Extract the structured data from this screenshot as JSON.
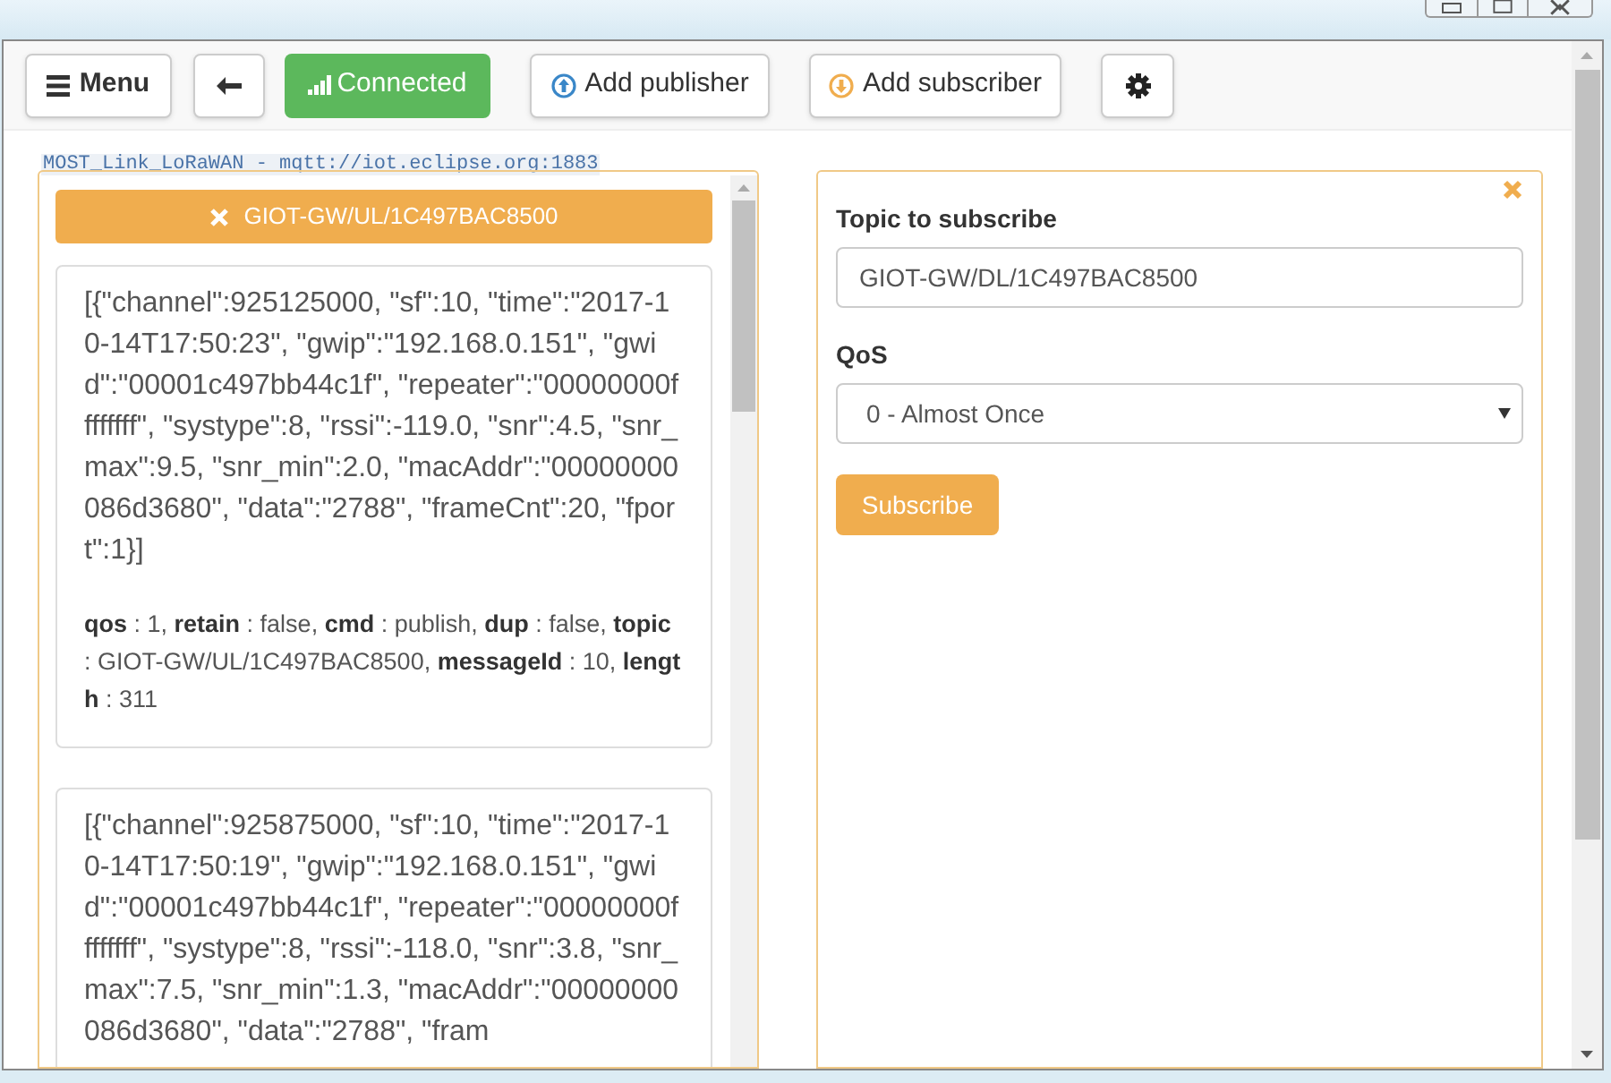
{
  "toolbar": {
    "menu": "Menu",
    "status": {
      "label": "Connected",
      "connected": true
    },
    "add_publisher": "Add publisher",
    "add_subscriber": "Add subscriber"
  },
  "connection": "MOST_Link_LoRaWAN - mqtt://iot.eclipse.org:1883",
  "subscription": {
    "topic": "GIOT-GW/UL/1C497BAC8500",
    "messages": [
      {
        "payload": "[{\"channel\":925125000, \"sf\":10, \"time\":\"2017-10-14T17:50:23\", \"gwip\":\"192.168.0.151\", \"gwid\":\"00001c497bb44c1f\", \"repeater\":\"00000000ffffffff\", \"systype\":8, \"rssi\":-119.0, \"snr\":4.5, \"snr_max\":9.5, \"snr_min\":2.0, \"macAddr\":\"00000000086d3680\", \"data\":\"2788\", \"frameCnt\":20, \"fport\":1}]",
        "meta": "**qos** : 1, **retain** : false, **cmd** : publish, **dup** : false, **topic** : GIOT-GW/UL/1C497BAC8500, **messageId** : 10, **length** : 311"
      },
      {
        "payload": "[{\"channel\":925875000, \"sf\":10, \"time\":\"2017-10-14T17:50:19\", \"gwip\":\"192.168.0.151\", \"gwid\":\"00001c497bb44c1f\", \"repeater\":\"00000000ffffffff\", \"systype\":8, \"rssi\":-118.0, \"snr\":3.8, \"snr_max\":7.5, \"snr_min\":1.3, \"macAddr\":\"00000000086d3680\", \"data\":\"2788\", \"fram"
      }
    ]
  },
  "subscribe_form": {
    "topic_label": "Topic to subscribe",
    "topic_value": "GIOT-GW/DL/1C497BAC8500",
    "qos_label": "QoS",
    "qos_value": "0 - Almost Once",
    "button": "Subscribe"
  }
}
